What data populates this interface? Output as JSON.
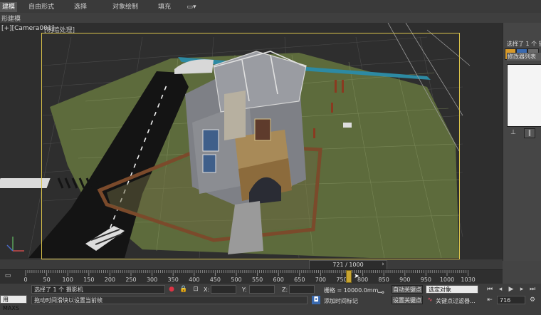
{
  "ribbon": {
    "tabs": [
      "建模",
      "自由形式",
      "选择",
      "对象绘制",
      "填充"
    ],
    "sub_label": "形建模"
  },
  "viewport": {
    "label": "[+][Camera001][明暗处理]",
    "label_main": "[+][Camera001]",
    "label_shading": "[明暗处理]"
  },
  "command_panel": {
    "selection_text": "选择了 1 个 摄",
    "modifier_list_label": "修改器列表"
  },
  "time_slider": {
    "frame_display": "721 / 1000"
  },
  "track_bar": {
    "ticks": [
      "0",
      "50",
      "100",
      "150",
      "200",
      "250",
      "300",
      "350",
      "400",
      "450",
      "500",
      "550",
      "600",
      "650",
      "700",
      "750",
      "800",
      "850",
      "900",
      "950",
      "1000",
      "1030"
    ]
  },
  "status": {
    "maxscript_label": "用 MAXS",
    "selection_status": "选择了 1 个 摄影机",
    "prompt_text": "拖动时间滑块以设置当前帧",
    "x_label": "X:",
    "y_label": "Y:",
    "z_label": "Z:",
    "grid_text": "栅格 = 10000.0mm",
    "add_time_tag": "添加时间标记",
    "auto_key": "自动关键点",
    "set_key": "设置关键点",
    "selected_object": "选定对象",
    "key_filters": "关键点过滤器...",
    "current_frame": "716"
  },
  "colors": {
    "accent": "#d9c24a",
    "playhead": "#c8a531",
    "grass": "#5d6b3c",
    "road": "#1a1a1a"
  }
}
